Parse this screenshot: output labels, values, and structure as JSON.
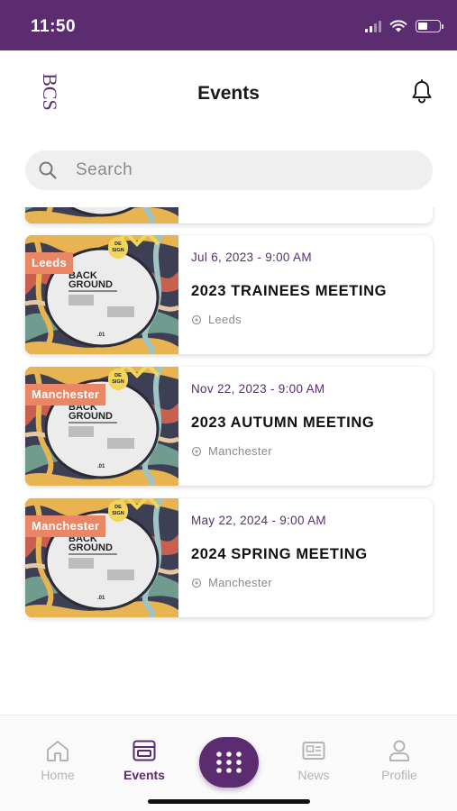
{
  "status_bar": {
    "time": "11:50"
  },
  "header": {
    "title": "Events",
    "logo_text": "BCS"
  },
  "search": {
    "placeholder": "Search"
  },
  "events": [
    {
      "tag": "Leeds",
      "date": "Jul 6, 2023 - 9:00 AM",
      "title": "2023 TRAINEES MEETING",
      "location": "Leeds"
    },
    {
      "tag": "Manchester",
      "date": "Nov 22, 2023 - 9:00 AM",
      "title": "2023 AUTUMN MEETING",
      "location": "Manchester"
    },
    {
      "tag": "Manchester",
      "date": "May 22, 2024 - 9:00 AM",
      "title": "2024 SPRING MEETING",
      "location": "Manchester"
    }
  ],
  "poster_text": {
    "line1": "BACK",
    "line2": "GROUND",
    "badge": "DE SIGN",
    "number": ".01"
  },
  "tabs": [
    {
      "label": "Home",
      "icon": "home-icon",
      "active": false
    },
    {
      "label": "Events",
      "icon": "calendar-icon",
      "active": true
    },
    {
      "label": "News",
      "icon": "newspaper-icon",
      "active": false
    },
    {
      "label": "Profile",
      "icon": "user-icon",
      "active": false
    }
  ],
  "colors": {
    "brand": "#5b2c6f",
    "tag": "#e98665"
  }
}
